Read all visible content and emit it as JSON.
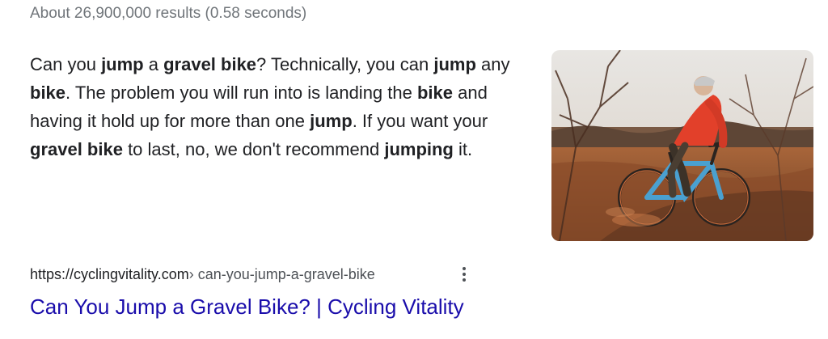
{
  "stats": {
    "text": "About 26,900,000 results (0.58 seconds)"
  },
  "snippet": {
    "segments": [
      {
        "text": "Can you ",
        "bold": false
      },
      {
        "text": "jump",
        "bold": true
      },
      {
        "text": " a ",
        "bold": false
      },
      {
        "text": "gravel bike",
        "bold": true
      },
      {
        "text": "? Technically, you can ",
        "bold": false
      },
      {
        "text": "jump",
        "bold": true
      },
      {
        "text": " any ",
        "bold": false
      },
      {
        "text": "bike",
        "bold": true
      },
      {
        "text": ". The problem you will run into is landing the ",
        "bold": false
      },
      {
        "text": "bike",
        "bold": true
      },
      {
        "text": " and having it hold up for more than one ",
        "bold": false
      },
      {
        "text": "jump",
        "bold": true
      },
      {
        "text": ". If you want your ",
        "bold": false
      },
      {
        "text": "gravel bike",
        "bold": true
      },
      {
        "text": " to last, no, we don't recommend ",
        "bold": false
      },
      {
        "text": "jumping",
        "bold": true
      },
      {
        "text": " it.",
        "bold": false
      }
    ]
  },
  "thumbnail": {
    "icon": "photo-cyclist-gravel-bike"
  },
  "result": {
    "domain": "https://cyclingvitality.com",
    "path": " › can-you-jump-a-gravel-bike",
    "title": "Can You Jump a Gravel Bike? | Cycling Vitality",
    "menu_icon": "more-vert-icon"
  },
  "colors": {
    "link": "#1a0dab",
    "text": "#202124",
    "muted": "#70757a"
  }
}
